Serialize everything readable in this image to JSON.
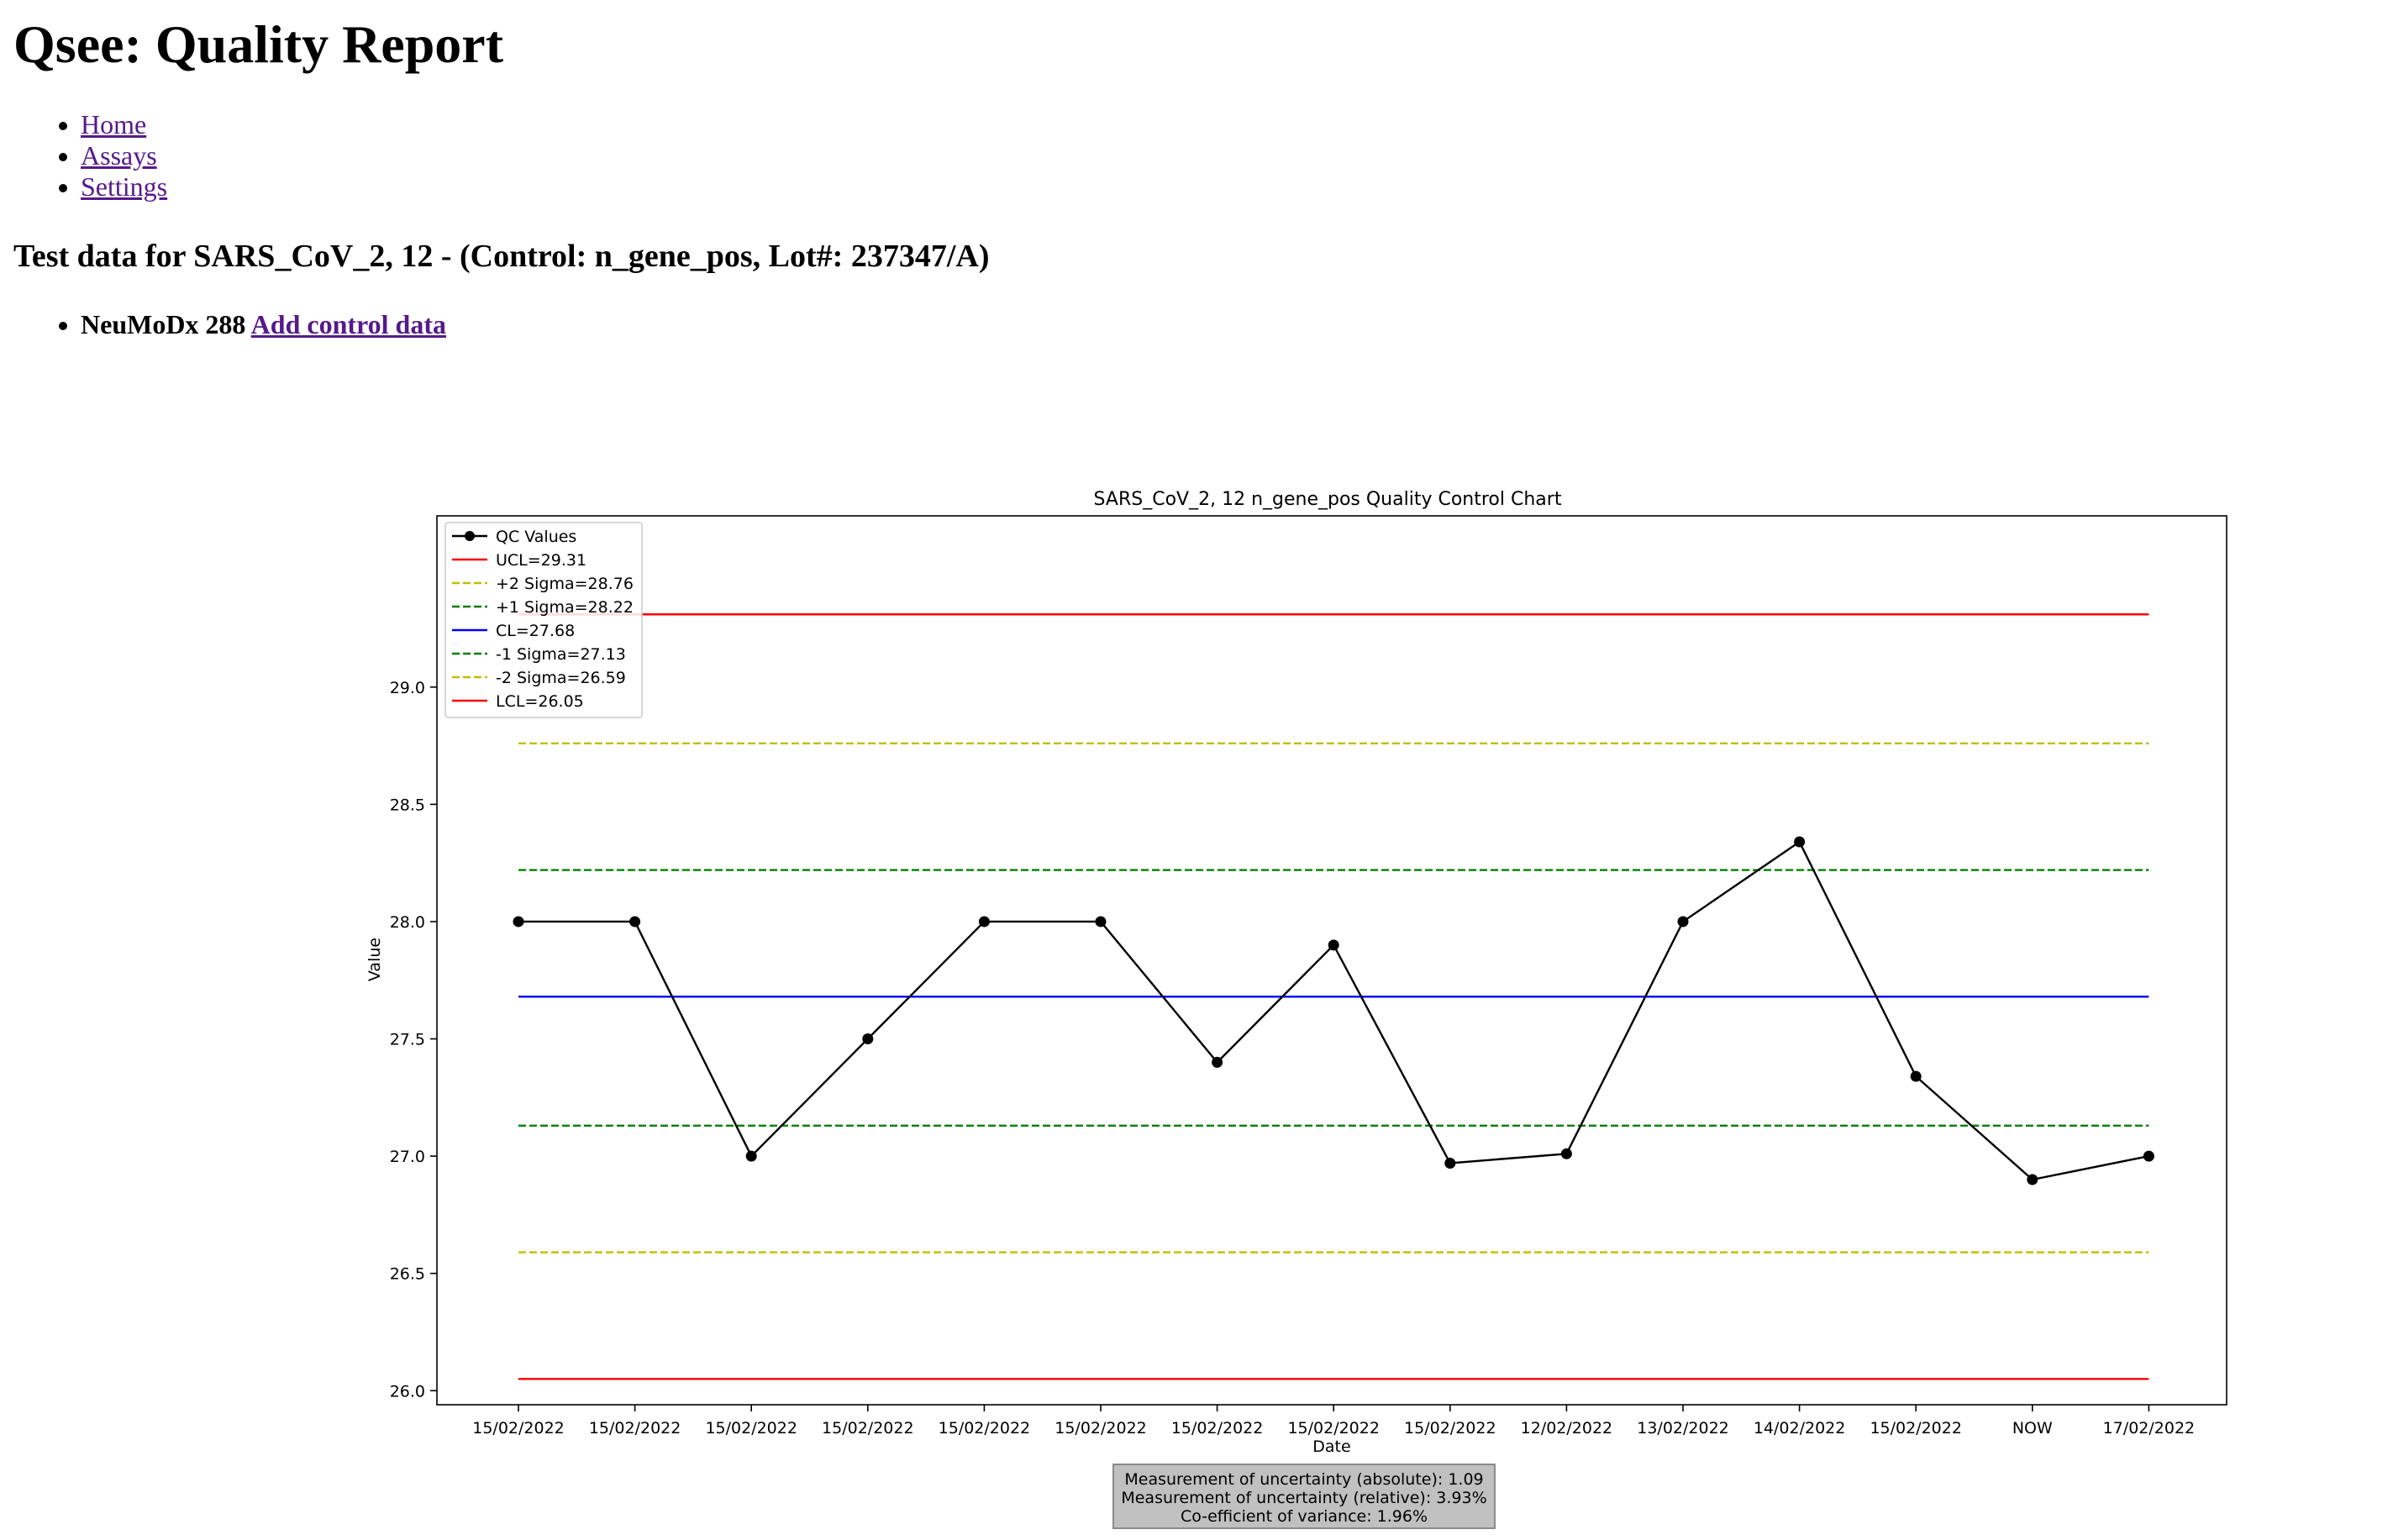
{
  "page": {
    "title": "Qsee: Quality Report"
  },
  "nav": {
    "items": [
      {
        "label": "Home"
      },
      {
        "label": "Assays"
      },
      {
        "label": "Settings"
      }
    ]
  },
  "section": {
    "title": "Test data for SARS_CoV_2, 12 - (Control: n_gene_pos, Lot#: 237347/A)"
  },
  "instruments": {
    "items": [
      {
        "name": "NeuMoDx 288",
        "action_label": "Add control data"
      }
    ]
  },
  "chart_data": {
    "type": "line",
    "title": "SARS_CoV_2, 12 n_gene_pos Quality Control Chart",
    "xlabel": "Date",
    "ylabel": "Value",
    "categories": [
      "15/02/2022",
      "15/02/2022",
      "15/02/2022",
      "15/02/2022",
      "15/02/2022",
      "15/02/2022",
      "15/02/2022",
      "15/02/2022",
      "15/02/2022",
      "12/02/2022",
      "13/02/2022",
      "14/02/2022",
      "15/02/2022",
      "NOW",
      "17/02/2022"
    ],
    "series": [
      {
        "name": "QC Values",
        "values": [
          28.0,
          28.0,
          27.0,
          27.5,
          28.0,
          28.0,
          27.4,
          27.9,
          26.97,
          27.01,
          28.0,
          28.34,
          27.34,
          26.9,
          27.0
        ],
        "color": "#000000"
      }
    ],
    "control_lines": [
      {
        "label": "UCL=29.31",
        "value": 29.31,
        "color": "#ff0000",
        "dashed": false
      },
      {
        "label": "+2 Sigma=28.76",
        "value": 28.76,
        "color": "#bfbf00",
        "dashed": true
      },
      {
        "label": "+1 Sigma=28.22",
        "value": 28.22,
        "color": "#008000",
        "dashed": true
      },
      {
        "label": "CL=27.68",
        "value": 27.68,
        "color": "#0000ff",
        "dashed": false
      },
      {
        "label": "-1 Sigma=27.13",
        "value": 27.13,
        "color": "#008000",
        "dashed": true
      },
      {
        "label": "-2 Sigma=26.59",
        "value": 26.59,
        "color": "#bfbf00",
        "dashed": true
      },
      {
        "label": "LCL=26.05",
        "value": 26.05,
        "color": "#ff0000",
        "dashed": false
      }
    ],
    "yticks": [
      "26.0",
      "26.5",
      "27.0",
      "27.5",
      "28.0",
      "28.5",
      "29.0"
    ],
    "ylim": [
      25.94,
      29.73
    ],
    "grid": false,
    "legend_position": "top-left"
  },
  "stats": {
    "uncertainty_absolute": "Measurement of uncertainty (absolute): 1.09",
    "uncertainty_relative": "Measurement of uncertainty (relative): 3.93%",
    "coefficient_of_variance": "Co-efficient of variance: 1.96%"
  }
}
